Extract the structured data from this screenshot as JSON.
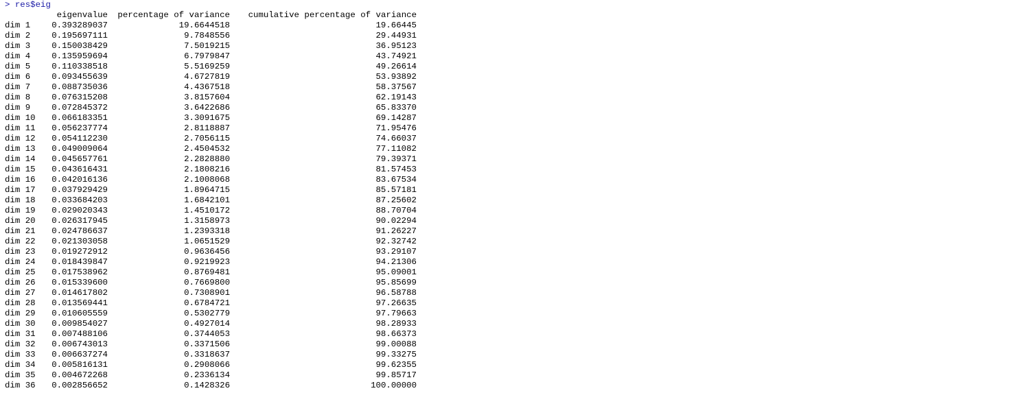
{
  "console": {
    "prompt": "> ",
    "command": "res$eig"
  },
  "table": {
    "headers": [
      "eigenvalue",
      "percentage of variance",
      "cumulative percentage of variance"
    ],
    "rows": [
      {
        "name": "dim 1",
        "eig": "0.393289037",
        "pct": "19.6644518",
        "cum": "19.66445"
      },
      {
        "name": "dim 2",
        "eig": "0.195697111",
        "pct": "9.7848556",
        "cum": "29.44931"
      },
      {
        "name": "dim 3",
        "eig": "0.150038429",
        "pct": "7.5019215",
        "cum": "36.95123"
      },
      {
        "name": "dim 4",
        "eig": "0.135959694",
        "pct": "6.7979847",
        "cum": "43.74921"
      },
      {
        "name": "dim 5",
        "eig": "0.110338518",
        "pct": "5.5169259",
        "cum": "49.26614"
      },
      {
        "name": "dim 6",
        "eig": "0.093455639",
        "pct": "4.6727819",
        "cum": "53.93892"
      },
      {
        "name": "dim 7",
        "eig": "0.088735036",
        "pct": "4.4367518",
        "cum": "58.37567"
      },
      {
        "name": "dim 8",
        "eig": "0.076315208",
        "pct": "3.8157604",
        "cum": "62.19143"
      },
      {
        "name": "dim 9",
        "eig": "0.072845372",
        "pct": "3.6422686",
        "cum": "65.83370"
      },
      {
        "name": "dim 10",
        "eig": "0.066183351",
        "pct": "3.3091675",
        "cum": "69.14287"
      },
      {
        "name": "dim 11",
        "eig": "0.056237774",
        "pct": "2.8118887",
        "cum": "71.95476"
      },
      {
        "name": "dim 12",
        "eig": "0.054112230",
        "pct": "2.7056115",
        "cum": "74.66037"
      },
      {
        "name": "dim 13",
        "eig": "0.049009064",
        "pct": "2.4504532",
        "cum": "77.11082"
      },
      {
        "name": "dim 14",
        "eig": "0.045657761",
        "pct": "2.2828880",
        "cum": "79.39371"
      },
      {
        "name": "dim 15",
        "eig": "0.043616431",
        "pct": "2.1808216",
        "cum": "81.57453"
      },
      {
        "name": "dim 16",
        "eig": "0.042016136",
        "pct": "2.1008068",
        "cum": "83.67534"
      },
      {
        "name": "dim 17",
        "eig": "0.037929429",
        "pct": "1.8964715",
        "cum": "85.57181"
      },
      {
        "name": "dim 18",
        "eig": "0.033684203",
        "pct": "1.6842101",
        "cum": "87.25602"
      },
      {
        "name": "dim 19",
        "eig": "0.029020343",
        "pct": "1.4510172",
        "cum": "88.70704"
      },
      {
        "name": "dim 20",
        "eig": "0.026317945",
        "pct": "1.3158973",
        "cum": "90.02294"
      },
      {
        "name": "dim 21",
        "eig": "0.024786637",
        "pct": "1.2393318",
        "cum": "91.26227"
      },
      {
        "name": "dim 22",
        "eig": "0.021303058",
        "pct": "1.0651529",
        "cum": "92.32742"
      },
      {
        "name": "dim 23",
        "eig": "0.019272912",
        "pct": "0.9636456",
        "cum": "93.29107"
      },
      {
        "name": "dim 24",
        "eig": "0.018439847",
        "pct": "0.9219923",
        "cum": "94.21306"
      },
      {
        "name": "dim 25",
        "eig": "0.017538962",
        "pct": "0.8769481",
        "cum": "95.09001"
      },
      {
        "name": "dim 26",
        "eig": "0.015339600",
        "pct": "0.7669800",
        "cum": "95.85699"
      },
      {
        "name": "dim 27",
        "eig": "0.014617802",
        "pct": "0.7308901",
        "cum": "96.58788"
      },
      {
        "name": "dim 28",
        "eig": "0.013569441",
        "pct": "0.6784721",
        "cum": "97.26635"
      },
      {
        "name": "dim 29",
        "eig": "0.010605559",
        "pct": "0.5302779",
        "cum": "97.79663"
      },
      {
        "name": "dim 30",
        "eig": "0.009854027",
        "pct": "0.4927014",
        "cum": "98.28933"
      },
      {
        "name": "dim 31",
        "eig": "0.007488106",
        "pct": "0.3744053",
        "cum": "98.66373"
      },
      {
        "name": "dim 32",
        "eig": "0.006743013",
        "pct": "0.3371506",
        "cum": "99.00088"
      },
      {
        "name": "dim 33",
        "eig": "0.006637274",
        "pct": "0.3318637",
        "cum": "99.33275"
      },
      {
        "name": "dim 34",
        "eig": "0.005816131",
        "pct": "0.2908066",
        "cum": "99.62355"
      },
      {
        "name": "dim 35",
        "eig": "0.004672268",
        "pct": "0.2336134",
        "cum": "99.85717"
      },
      {
        "name": "dim 36",
        "eig": "0.002856652",
        "pct": "0.1428326",
        "cum": "100.00000"
      }
    ]
  }
}
